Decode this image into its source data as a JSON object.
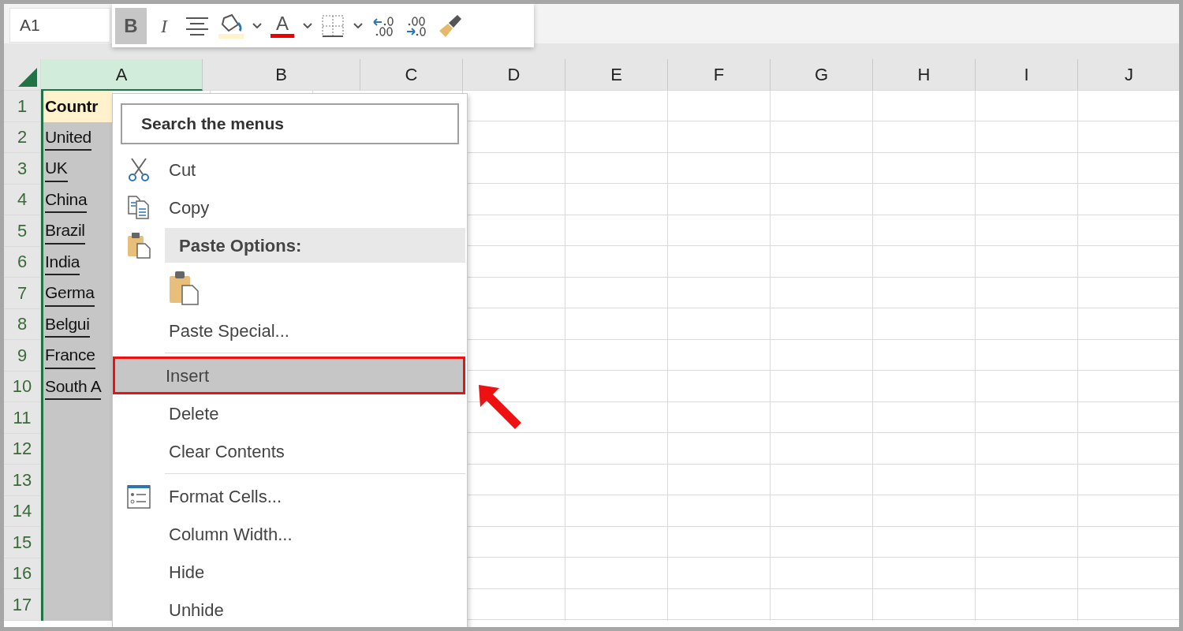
{
  "name_box": {
    "value": "A1"
  },
  "mini_toolbar": {
    "tools": [
      {
        "kind": "bold",
        "label": "B",
        "selected": true
      },
      {
        "kind": "italic",
        "label": "I",
        "selected": false
      },
      {
        "kind": "align",
        "selected": false
      },
      {
        "kind": "fill",
        "selected": false,
        "dropdown": true
      },
      {
        "kind": "font-color",
        "label": "A",
        "selected": false,
        "dropdown": true
      },
      {
        "kind": "borders",
        "selected": false,
        "dropdown": true
      },
      {
        "kind": "increase-decimal",
        "selected": false
      },
      {
        "kind": "decrease-decimal",
        "selected": false
      },
      {
        "kind": "painter",
        "selected": false
      }
    ]
  },
  "columns": [
    {
      "label": "A",
      "selected": true
    },
    {
      "label": "B",
      "selected": false
    },
    {
      "label": "C",
      "selected": false
    },
    {
      "label": "D",
      "selected": false
    },
    {
      "label": "E",
      "selected": false
    },
    {
      "label": "F",
      "selected": false
    },
    {
      "label": "G",
      "selected": false
    },
    {
      "label": "H",
      "selected": false
    },
    {
      "label": "I",
      "selected": false
    },
    {
      "label": "J",
      "selected": false
    }
  ],
  "rows": [
    {
      "header": "1",
      "kind": "header",
      "cells": [
        "Countr"
      ]
    },
    {
      "header": "2",
      "kind": "data",
      "cells": [
        "United"
      ]
    },
    {
      "header": "3",
      "kind": "data",
      "cells": [
        "UK"
      ]
    },
    {
      "header": "4",
      "kind": "data",
      "cells": [
        "China"
      ]
    },
    {
      "header": "5",
      "kind": "data",
      "cells": [
        "Brazil"
      ]
    },
    {
      "header": "6",
      "kind": "data",
      "cells": [
        "India"
      ]
    },
    {
      "header": "7",
      "kind": "data",
      "cells": [
        "Germa"
      ]
    },
    {
      "header": "8",
      "kind": "data",
      "cells": [
        "Belgui"
      ]
    },
    {
      "header": "9",
      "kind": "data",
      "cells": [
        "France"
      ]
    },
    {
      "header": "10",
      "kind": "data",
      "cells": [
        "South A"
      ]
    },
    {
      "header": "11",
      "kind": "empty"
    },
    {
      "header": "12",
      "kind": "empty"
    },
    {
      "header": "13",
      "kind": "empty"
    },
    {
      "header": "14",
      "kind": "empty"
    },
    {
      "header": "15",
      "kind": "empty"
    },
    {
      "header": "16",
      "kind": "empty"
    },
    {
      "header": "17",
      "kind": "empty"
    }
  ],
  "context_menu": {
    "search": {
      "placeholder": "Search the menus"
    },
    "items": [
      {
        "kind": "cut",
        "label": "Cut",
        "selected": false,
        "marked": false
      },
      {
        "kind": "copy",
        "label": "Copy",
        "selected": false,
        "marked": false
      },
      {
        "kind": "paste-header",
        "label": "Paste Options:"
      },
      {
        "kind": "paste-button"
      },
      {
        "kind": "command",
        "label": "Paste Special...",
        "selected": false,
        "marked": false
      },
      {
        "kind": "separator"
      },
      {
        "kind": "command",
        "label": "Insert",
        "selected": true,
        "marked": true
      },
      {
        "kind": "command",
        "label": "Delete",
        "selected": false,
        "marked": false
      },
      {
        "kind": "command",
        "label": "Clear Contents",
        "selected": false,
        "marked": false
      },
      {
        "kind": "separator"
      },
      {
        "kind": "format-cells",
        "label": "Format Cells...",
        "selected": false,
        "marked": false
      },
      {
        "kind": "command",
        "label": "Column Width...",
        "selected": false,
        "marked": false
      },
      {
        "kind": "command",
        "label": "Hide",
        "selected": false,
        "marked": false
      },
      {
        "kind": "command",
        "label": "Unhide",
        "selected": false,
        "marked": false
      }
    ]
  }
}
